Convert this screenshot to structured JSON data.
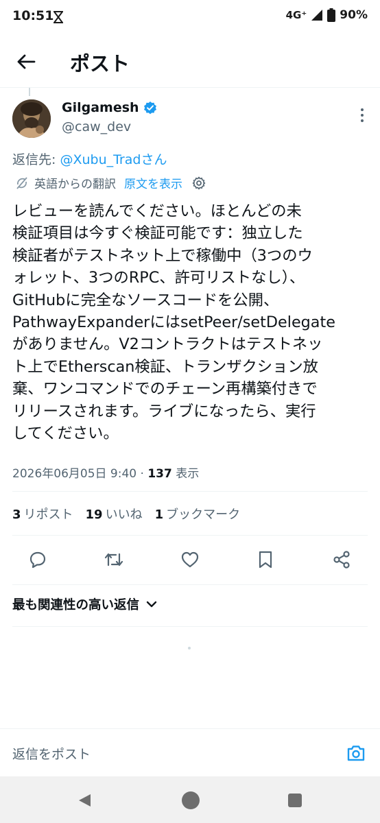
{
  "status_bar": {
    "time": "10:51",
    "network": "4G⁺",
    "battery": "90%"
  },
  "header": {
    "title": "ポスト"
  },
  "post": {
    "author_name": "Gilgamesh",
    "author_handle": "@caw_dev",
    "reply_to_prefix": "返信先: ",
    "reply_to_mention": "@Xubu_Trad",
    "reply_to_suffix": "さん",
    "translated_label": "英語からの翻訳",
    "show_original_label": "原文を表示",
    "body_lines": [
      "レビューを読んでください。ほとんどの未",
      "検証項目は今すぐ検証可能です：独立した",
      "検証者がテストネット上で稼働中（3つのウ",
      "ォレット、3つのRPC、許可リストなし）、",
      "GitHubに完全なソースコードを公開、",
      "PathwayExpanderにはsetPeer/setDelegate",
      "がありません。V2コントラクトはテストネッ",
      "ト上でEtherscan検証、トランザクション放",
      "棄、ワンコマンドでのチェーン再構築付きで",
      "リリースされます。ライブになったら、実行",
      "してください。"
    ],
    "timestamp": "2026年06月05日 9:40",
    "separator": " · ",
    "views_count": "137",
    "views_label": " 表示"
  },
  "stats": {
    "reposts_count": "3",
    "reposts_label": "リポスト",
    "likes_count": "19",
    "likes_label": "いいね",
    "bookmarks_count": "1",
    "bookmarks_label": "ブックマーク"
  },
  "actions": {
    "icons": [
      "reply-icon",
      "repost-icon",
      "like-icon",
      "bookmark-icon",
      "share-icon"
    ]
  },
  "replies": {
    "sort_label": "最も関連性の高い返信"
  },
  "composer": {
    "placeholder": "返信をポスト"
  },
  "colors": {
    "accent": "#1d9bf0",
    "text_primary": "#0f1419",
    "text_secondary": "#536471",
    "divider": "#eff3f4",
    "verified": "#1d9bf0"
  }
}
